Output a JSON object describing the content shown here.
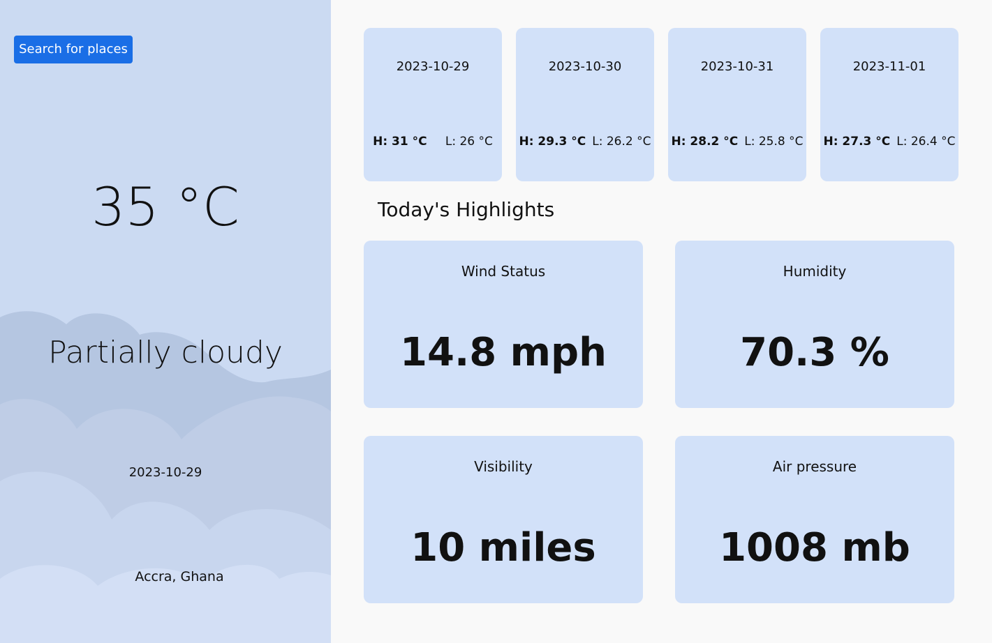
{
  "sidebar": {
    "search_label": "Search for places",
    "temperature": "35 °C",
    "condition": "Partially cloudy",
    "date": "2023-10-29",
    "location": "Accra, Ghana"
  },
  "forecast": [
    {
      "date": "2023-10-29",
      "high": "H: 31 °C",
      "low": "L: 26 °C"
    },
    {
      "date": "2023-10-30",
      "high": "H: 29.3 °C",
      "low": "L: 26.2 °C"
    },
    {
      "date": "2023-10-31",
      "high": "H: 28.2 °C",
      "low": "L: 25.8 °C"
    },
    {
      "date": "2023-11-01",
      "high": "H: 27.3 °C",
      "low": "L: 26.4 °C"
    }
  ],
  "highlights": {
    "title": "Today's Highlights",
    "wind": {
      "label": "Wind Status",
      "value": "14.8 mph"
    },
    "humidity": {
      "label": "Humidity",
      "value": "70.3 %"
    },
    "visibility": {
      "label": "Visibility",
      "value": "10 miles"
    },
    "pressure": {
      "label": "Air pressure",
      "value": "1008 mb"
    }
  },
  "colors": {
    "sidebar_bg": "#cbdaf2",
    "card_bg": "#d2e1f9",
    "accent": "#1a6ee6",
    "page_bg": "#f9f9f9"
  }
}
